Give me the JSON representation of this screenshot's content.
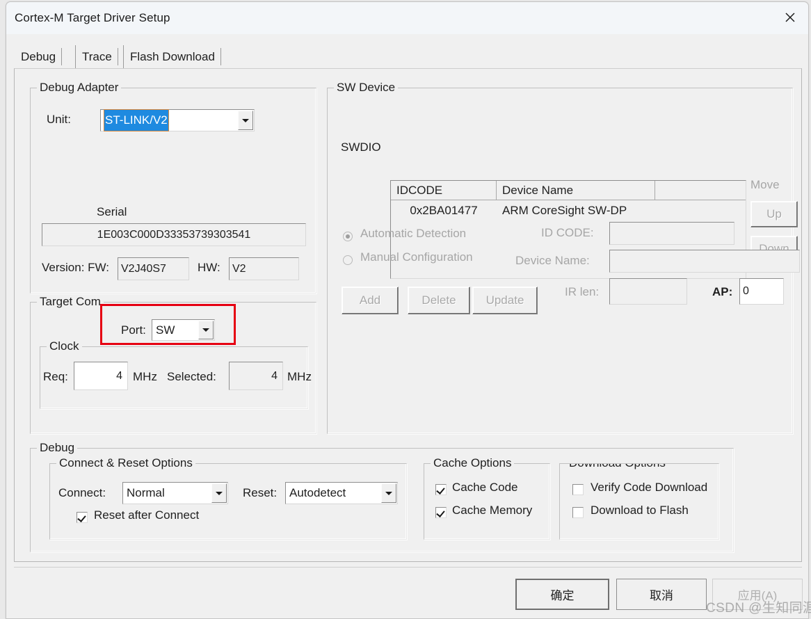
{
  "window": {
    "title": "Cortex-M Target Driver Setup",
    "close_icon": "close-icon"
  },
  "tabs": [
    {
      "label": "Debug",
      "active": true
    },
    {
      "label": "Trace",
      "active": false
    },
    {
      "label": "Flash Download",
      "active": false
    }
  ],
  "debug_adapter": {
    "group_label": "Debug Adapter",
    "unit_label": "Unit:",
    "unit_value": "ST-LINK/V2",
    "unit_dropdown_icon": "chevron-down-icon",
    "serial_label": "Serial",
    "serial_value": "1E003C000D33353739303541",
    "version_label": "Version: FW:",
    "fw_value": "V2J40S7",
    "hw_label": "HW:",
    "hw_value": "V2"
  },
  "sw_device": {
    "group_label": "SW Device",
    "bus_label": "SWDIO",
    "columns": [
      "IDCODE",
      "Device Name",
      ""
    ],
    "rows": [
      {
        "idcode": "0x2BA01477",
        "device_name": "ARM CoreSight SW-DP",
        "extra": ""
      }
    ],
    "move_label": "Move",
    "up_label": "Up",
    "down_label": "Down",
    "automatic_detection_label": "Automatic Detection",
    "manual_configuration_label": "Manual Configuration",
    "automatic_selected": true,
    "id_code_label": "ID CODE:",
    "id_code_value": "",
    "device_name_label": "Device Name:",
    "device_name_value": "",
    "ir_len_label": "IR len:",
    "ir_len_value": "",
    "ap_label": "AP:",
    "ap_value": "0",
    "add_label": "Add",
    "delete_label": "Delete",
    "update_label": "Update"
  },
  "target_com": {
    "group_label": "Target Com",
    "port_label": "Port:",
    "port_value": "SW",
    "port_dropdown_icon": "chevron-down-icon",
    "clock_group_label": "Clock",
    "req_label": "Req:",
    "req_value": "4",
    "req_unit": "MHz",
    "selected_label": "Selected:",
    "selected_value": "4",
    "selected_unit": "MHz"
  },
  "debug_section": {
    "group_label": "Debug",
    "connect_reset_group_label": "Connect & Reset Options",
    "connect_label": "Connect:",
    "connect_value": "Normal",
    "connect_dropdown_icon": "chevron-down-icon",
    "reset_label": "Reset:",
    "reset_value": "Autodetect",
    "reset_dropdown_icon": "chevron-down-icon",
    "reset_after_connect_label": "Reset after Connect",
    "reset_after_connect_checked": true,
    "cache_group_label": "Cache Options",
    "cache_code_label": "Cache Code",
    "cache_code_checked": true,
    "cache_memory_label": "Cache Memory",
    "cache_memory_checked": true,
    "download_group_label": "Download Options",
    "verify_code_download_label": "Verify Code Download",
    "verify_code_download_checked": false,
    "download_to_flash_label": "Download to Flash",
    "download_to_flash_checked": false
  },
  "footer": {
    "ok_label": "确定",
    "cancel_label": "取消",
    "apply_label": "应用(A)",
    "apply_disabled": true
  },
  "annotation": {
    "highlight_color": "#e60012",
    "target": "port-combobox"
  },
  "watermark": "CSDN @生知同涯"
}
